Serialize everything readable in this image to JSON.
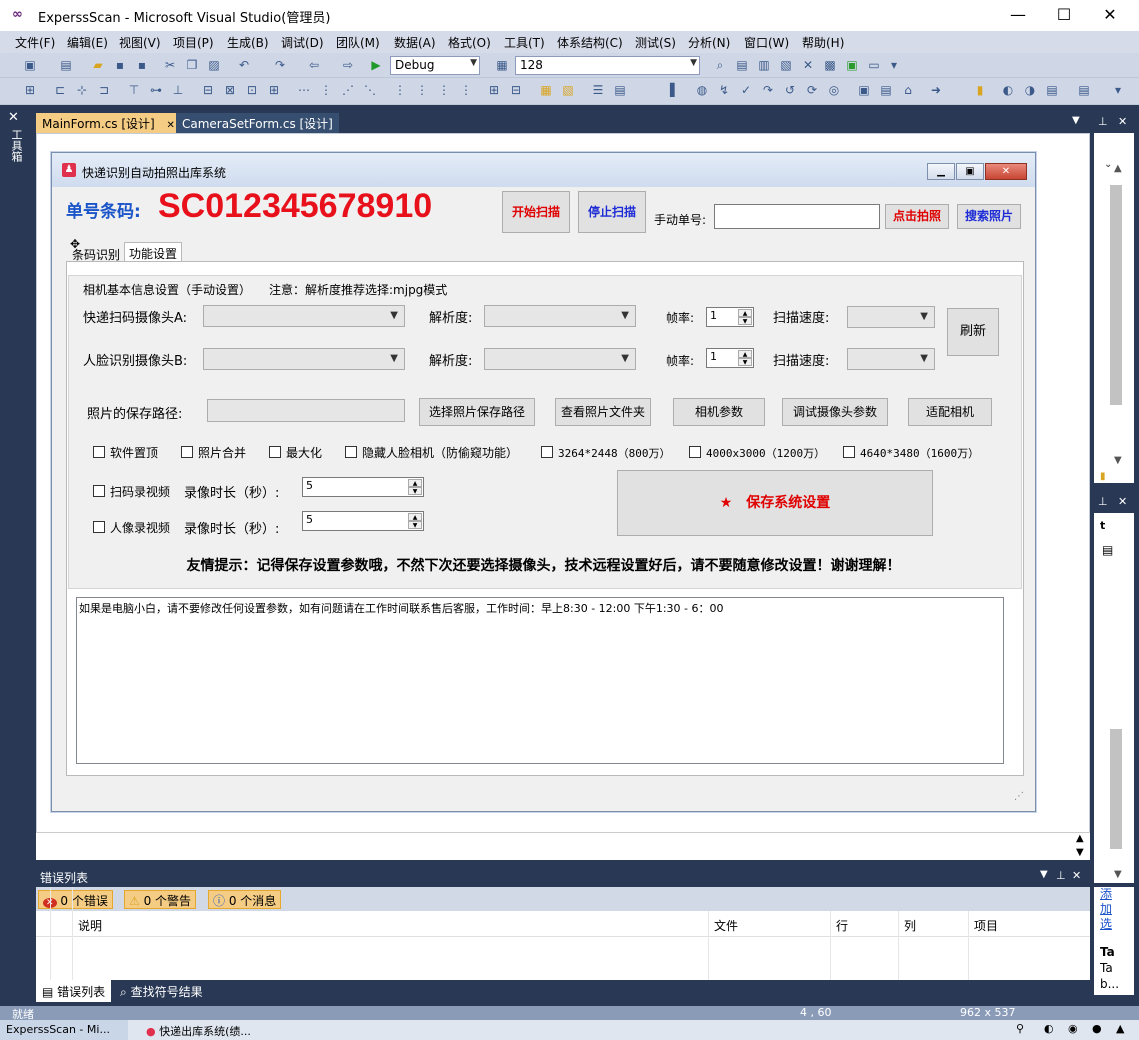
{
  "window": {
    "title": "ExperssScan - Microsoft Visual Studio(管理员)",
    "minimize": "—",
    "maximize": "☐",
    "close": "✕"
  },
  "menu": [
    "文件(F)",
    "编辑(E)",
    "视图(V)",
    "项目(P)",
    "生成(B)",
    "调试(D)",
    "团队(M)",
    "数据(A)",
    "格式(O)",
    "工具(T)",
    "体系结构(C)",
    "测试(S)",
    "分析(N)",
    "窗口(W)",
    "帮助(H)"
  ],
  "toolbar": {
    "config": "Debug",
    "font_size": "128"
  },
  "left_dock": {
    "toolbox": "工具箱"
  },
  "doc_tabs": [
    {
      "label": "MainForm.cs [设计]",
      "active": true
    },
    {
      "label": "CameraSetForm.cs [设计]",
      "active": false
    }
  ],
  "form": {
    "title": "快递识别自动拍照出库系统",
    "barcode_label": "单号条码:",
    "barcode_value": "SC012345678910",
    "start_scan": "开始扫描",
    "stop_scan": "停止扫描",
    "manual_label": "手动单号:",
    "manual_value": "",
    "take_photo": "点击拍照",
    "search_photo": "搜索照片",
    "tabs": [
      "条码识别",
      "功能设置"
    ],
    "group_title": "相机基本信息设置（手动设置）",
    "note": "注意：解析度推荐选择:mjpg模式",
    "camera_a": "快递扫码摄像头A:",
    "camera_b": "人脸识别摄像头B:",
    "resolution": "解析度:",
    "fps": "帧率:",
    "fps_a": "1",
    "fps_b": "1",
    "scan_speed": "扫描速度:",
    "refresh": "刷新",
    "photo_path_label": "照片的保存路径:",
    "photo_path_value": "",
    "buttons": [
      "选择照片保存路径",
      "查看照片文件夹",
      "相机参数",
      "调试摄像头参数",
      "适配相机"
    ],
    "checks": [
      "软件置顶",
      "照片合并",
      "最大化",
      "隐藏人脸相机（防偷窥功能）",
      "3264*2448（800万）",
      "4000x3000（1200万）",
      "4640*3480（1600万）"
    ],
    "scan_record": "扫码录视频",
    "face_record": "人像录视频",
    "record_duration": "录像时长（秒）:",
    "record_scan_value": "5",
    "record_face_value": "5",
    "save_settings": "保存系统设置",
    "tip": "友情提示：记得保存设置参数哦，不然下次还要选择摄像头，技术远程设置好后，请不要随意修改设置！谢谢理解！",
    "notes": "如果是电脑小白，请不要修改任何设置参数，如有问题请在工作时间联系售后客服，工作时间：早上8:30 - 12:00 下午1:30 - 6：00"
  },
  "error_list": {
    "title": "错误列表",
    "errors": "0 个错误",
    "warnings": "0 个警告",
    "messages": "0 个消息",
    "columns": [
      "说明",
      "文件",
      "行",
      "列",
      "项目"
    ]
  },
  "bottom_tabs": [
    "错误列表",
    "查找符号结果"
  ],
  "right_dock": {
    "add_link": "添加选",
    "ta": "Ta",
    "ta2": "Ta",
    "b": "b..."
  },
  "status": {
    "ready": "就绪",
    "position": "4 , 60",
    "size": "962 x 537"
  },
  "taskbar": {
    "item1": "ExperssScan - Mi...",
    "item2": "快递出库系统(绩...",
    "icons": [
      "search-icon",
      "app-icon"
    ]
  }
}
